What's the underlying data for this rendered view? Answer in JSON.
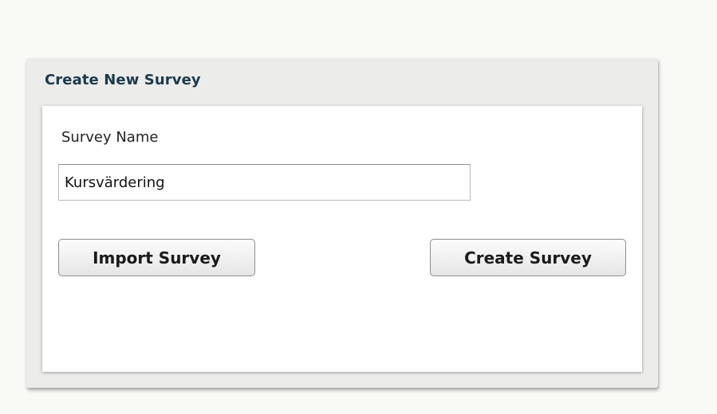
{
  "dialog": {
    "title": "Create New Survey"
  },
  "form": {
    "survey_name_label": "Survey Name",
    "survey_name_value": "Kursvärdering"
  },
  "buttons": {
    "import_label": "Import Survey",
    "create_label": "Create Survey"
  }
}
